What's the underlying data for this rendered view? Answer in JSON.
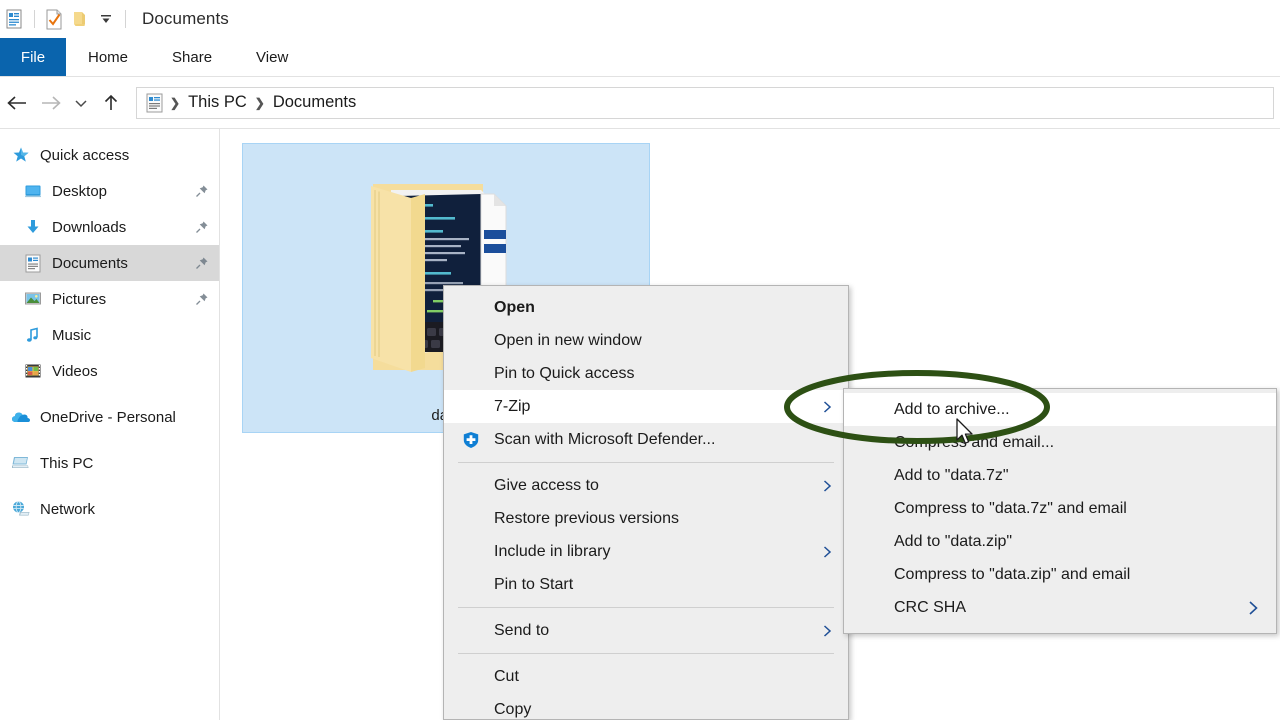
{
  "window": {
    "title": "Documents",
    "quick_access_icons": [
      "document-properties-icon",
      "checkmark-file-icon",
      "new-folder-icon",
      "chevron-down-icon"
    ]
  },
  "ribbon": {
    "tabs": [
      {
        "label": "File",
        "active": true
      },
      {
        "label": "Home",
        "active": false
      },
      {
        "label": "Share",
        "active": false
      },
      {
        "label": "View",
        "active": false
      }
    ],
    "file_tab_color": "#0a64ad"
  },
  "navbar": {
    "back_icon": "arrow-left-icon",
    "forward_icon": "arrow-right-icon",
    "recent_icon": "chevron-down-icon",
    "up_icon": "arrow-up-icon",
    "address_icon": "documents-folder-icon",
    "breadcrumbs": [
      "This PC",
      "Documents"
    ],
    "separator": "❯"
  },
  "sidebar": {
    "items": [
      {
        "label": "Quick access",
        "icon": "star-icon",
        "indent": 0,
        "pinned": false,
        "selected": false
      },
      {
        "label": "Desktop",
        "icon": "desktop-icon",
        "indent": 1,
        "pinned": true,
        "selected": false
      },
      {
        "label": "Downloads",
        "icon": "download-icon",
        "indent": 1,
        "pinned": true,
        "selected": false
      },
      {
        "label": "Documents",
        "icon": "document-icon",
        "indent": 1,
        "pinned": true,
        "selected": true
      },
      {
        "label": "Pictures",
        "icon": "picture-icon",
        "indent": 1,
        "pinned": true,
        "selected": false
      },
      {
        "label": "Music",
        "icon": "music-note-icon",
        "indent": 1,
        "pinned": false,
        "selected": false
      },
      {
        "label": "Videos",
        "icon": "video-icon",
        "indent": 1,
        "pinned": false,
        "selected": false
      },
      {
        "label": "OneDrive - Personal",
        "icon": "cloud-icon",
        "indent": 0,
        "pinned": false,
        "selected": false,
        "spaced": true
      },
      {
        "label": "This PC",
        "icon": "computer-icon",
        "indent": 0,
        "pinned": false,
        "selected": false,
        "spaced": true
      },
      {
        "label": "Network",
        "icon": "network-icon",
        "indent": 0,
        "pinned": false,
        "selected": false,
        "spaced": true
      }
    ]
  },
  "content": {
    "selected_file": {
      "name": "data",
      "icon": "folder-with-thumbnail-icon",
      "selected": true
    }
  },
  "context_menu": {
    "items": [
      {
        "label": "Open",
        "bold": true,
        "icon": null,
        "arrow": false,
        "hover": false
      },
      {
        "label": "Open in new window",
        "bold": false,
        "icon": null,
        "arrow": false,
        "hover": false
      },
      {
        "label": "Pin to Quick access",
        "bold": false,
        "icon": null,
        "arrow": false,
        "hover": false
      },
      {
        "label": "7-Zip",
        "bold": false,
        "icon": null,
        "arrow": true,
        "hover": true
      },
      {
        "label": "Scan with Microsoft Defender...",
        "bold": false,
        "icon": "shield-icon",
        "arrow": false,
        "hover": false
      },
      {
        "divider": true
      },
      {
        "label": "Give access to",
        "bold": false,
        "icon": null,
        "arrow": true,
        "hover": false
      },
      {
        "label": "Restore previous versions",
        "bold": false,
        "icon": null,
        "arrow": false,
        "hover": false
      },
      {
        "label": "Include in library",
        "bold": false,
        "icon": null,
        "arrow": true,
        "hover": false
      },
      {
        "label": "Pin to Start",
        "bold": false,
        "icon": null,
        "arrow": false,
        "hover": false
      },
      {
        "divider": true
      },
      {
        "label": "Send to",
        "bold": false,
        "icon": null,
        "arrow": true,
        "hover": false
      },
      {
        "divider": true
      },
      {
        "label": "Cut",
        "bold": false,
        "icon": null,
        "arrow": false,
        "hover": false
      },
      {
        "label": "Copy",
        "bold": false,
        "icon": null,
        "arrow": false,
        "hover": false
      }
    ]
  },
  "submenu": {
    "title": "7-Zip",
    "items": [
      {
        "label": "Add to archive...",
        "arrow": false,
        "hover": true
      },
      {
        "label": "Compress and email...",
        "arrow": false,
        "hover": false
      },
      {
        "label": "Add to \"data.7z\"",
        "arrow": false,
        "hover": false
      },
      {
        "label": "Compress to \"data.7z\" and email",
        "arrow": false,
        "hover": false
      },
      {
        "label": "Add to \"data.zip\"",
        "arrow": false,
        "hover": false
      },
      {
        "label": "Compress to \"data.zip\" and email",
        "arrow": false,
        "hover": false
      },
      {
        "label": "CRC SHA",
        "arrow": true,
        "hover": false
      }
    ]
  },
  "annotation": {
    "shape": "ellipse",
    "color": "#2d5014",
    "target": "Add to archive..."
  },
  "cursor": {
    "icon": "arrow-cursor-icon"
  }
}
